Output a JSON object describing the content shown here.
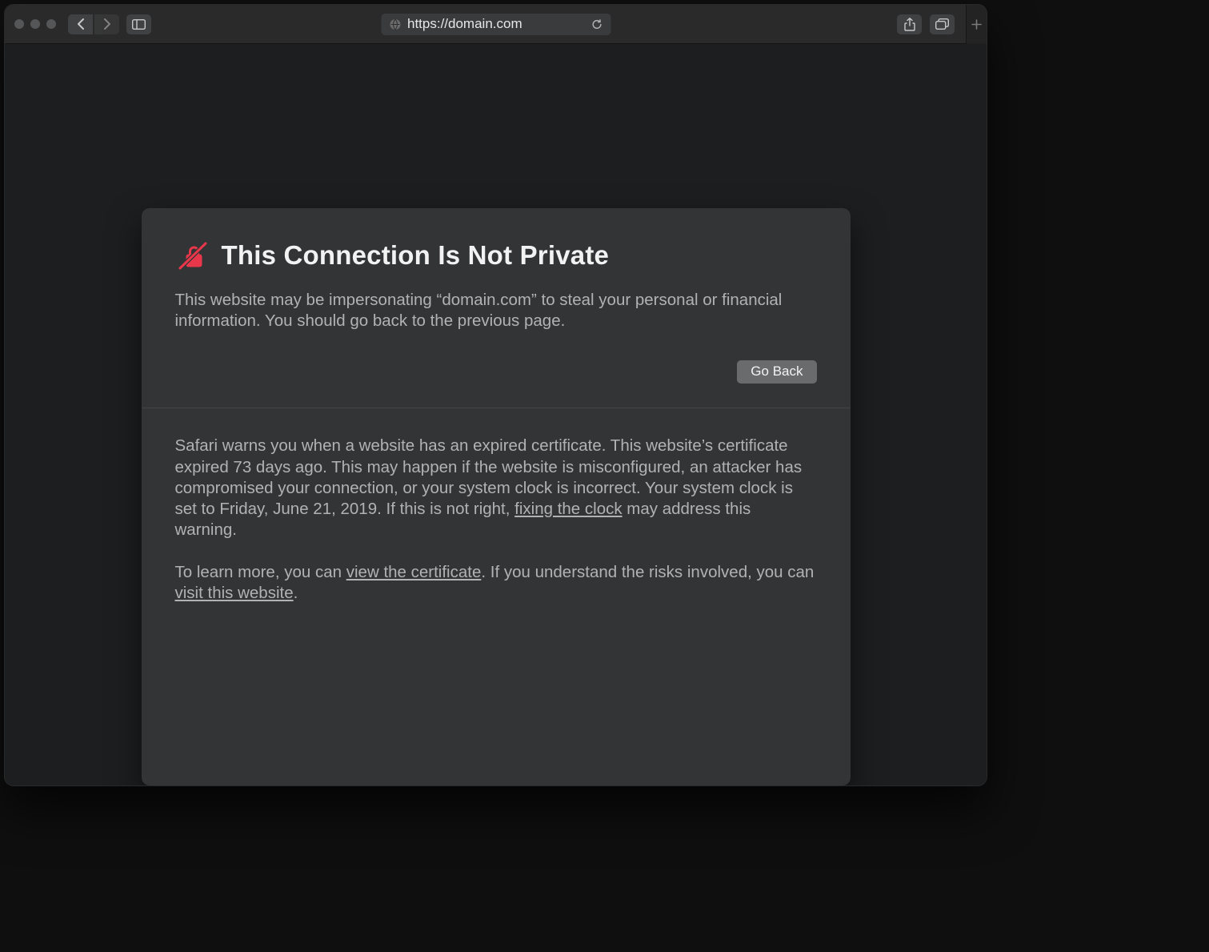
{
  "address_bar": {
    "url": "https://domain.com"
  },
  "warning": {
    "title": "This Connection Is Not Private",
    "description": "This website may be impersonating “domain.com” to steal your personal or financial information. You should go back to the previous page.",
    "go_back_label": "Go Back",
    "details_p1_a": "Safari warns you when a website has an expired certificate. This website’s certificate expired 73 days ago. This may happen if the website is misconfigured, an attacker has compromised your connection, or your system clock is incorrect. Your system clock is set to Friday, June 21, 2019. If this is not right, ",
    "link_fix_clock": "fixing the clock",
    "details_p1_b": " may address this warning.",
    "details_p2_a": "To learn more, you can ",
    "link_view_cert": "view the certificate",
    "details_p2_b": ". If you understand the risks involved, you can ",
    "link_visit": "visit this website",
    "details_p2_c": "."
  }
}
